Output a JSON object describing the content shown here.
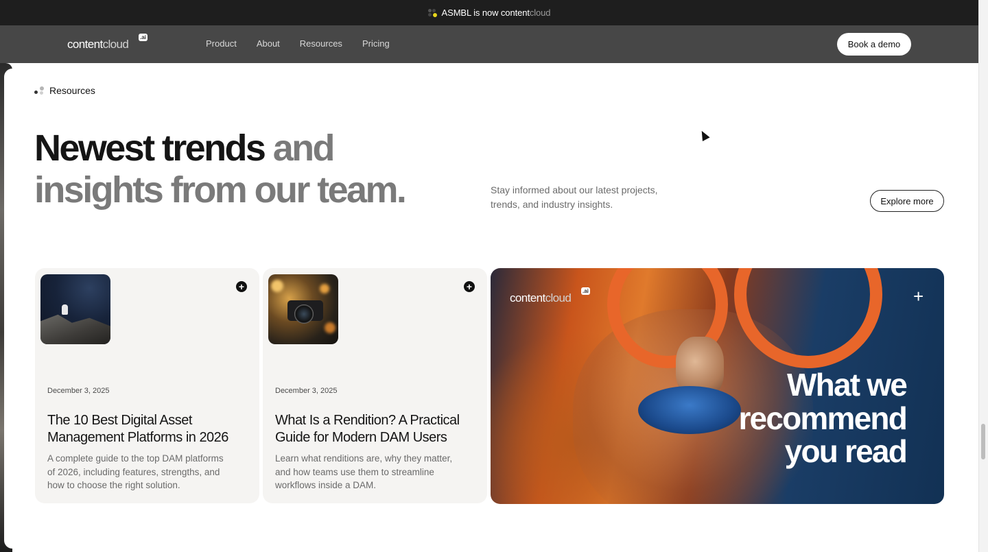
{
  "announcement": {
    "prefix": "ASMBL is now content",
    "suffix": "cloud"
  },
  "nav": {
    "logo": {
      "main": "content",
      "light": "cloud",
      "badge": ".ai"
    },
    "links": [
      "Product",
      "About",
      "Resources",
      "Pricing"
    ],
    "cta_label": "Book a demo"
  },
  "section": {
    "eyebrow": "Resources",
    "headline_strong": "Newest trends",
    "headline_muted_1": "and",
    "headline_muted_2": "insights from our team.",
    "subtext": "Stay informed about our latest projects, trends, and industry insights.",
    "explore_label": "Explore more"
  },
  "cards": [
    {
      "date": "December 3, 2025",
      "title": "The 10 Best Digital Asset Management Platforms in 2026",
      "description": "A complete guide to the top DAM platforms of 2026, including features, strengths, and how to choose the right solution.",
      "icon": "plus-circle-icon"
    },
    {
      "date": "December 3, 2025",
      "title": "What Is a Rendition? A Practical Guide for Modern DAM Users",
      "description": "Learn what renditions are, why they matter, and how teams use them to streamline workflows inside a DAM.",
      "icon": "plus-circle-icon"
    }
  ],
  "feature": {
    "logo": {
      "main": "content",
      "light": "cloud",
      "badge": ".ai"
    },
    "title": "What we recommend you read",
    "icon": "plus-icon"
  },
  "colors": {
    "nav_bg": "#474747",
    "announce_bg": "#1e1e1e",
    "card_bg": "#f5f4f2",
    "accent_yellow": "#e7d61c"
  }
}
